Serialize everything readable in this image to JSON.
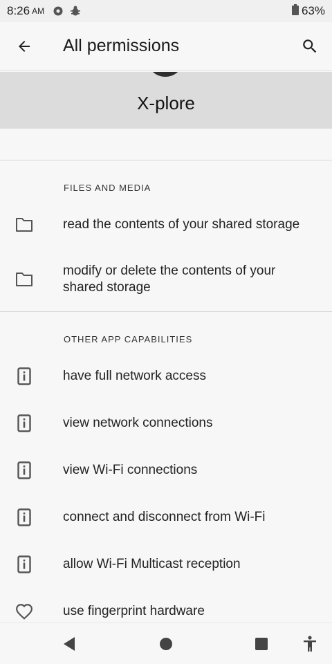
{
  "status_bar": {
    "time": "8:26",
    "ampm": "AM",
    "battery": "63%"
  },
  "app_bar": {
    "title": "All permissions"
  },
  "app": {
    "name": "X-plore"
  },
  "sections": [
    {
      "label": "FILES AND MEDIA",
      "items": [
        {
          "text": "read the contents of your shared storage",
          "icon": "folder-icon"
        },
        {
          "text": "modify or delete the contents of your shared storage",
          "icon": "folder-icon"
        }
      ]
    },
    {
      "label": "OTHER APP CAPABILITIES",
      "items": [
        {
          "text": "have full network access",
          "icon": "device-info-icon"
        },
        {
          "text": "view network connections",
          "icon": "device-info-icon"
        },
        {
          "text": "view Wi-Fi connections",
          "icon": "device-info-icon"
        },
        {
          "text": "connect and disconnect from Wi-Fi",
          "icon": "device-info-icon"
        },
        {
          "text": "allow Wi-Fi Multicast reception",
          "icon": "device-info-icon"
        },
        {
          "text": "use fingerprint hardware",
          "icon": "heart-icon"
        }
      ]
    }
  ]
}
